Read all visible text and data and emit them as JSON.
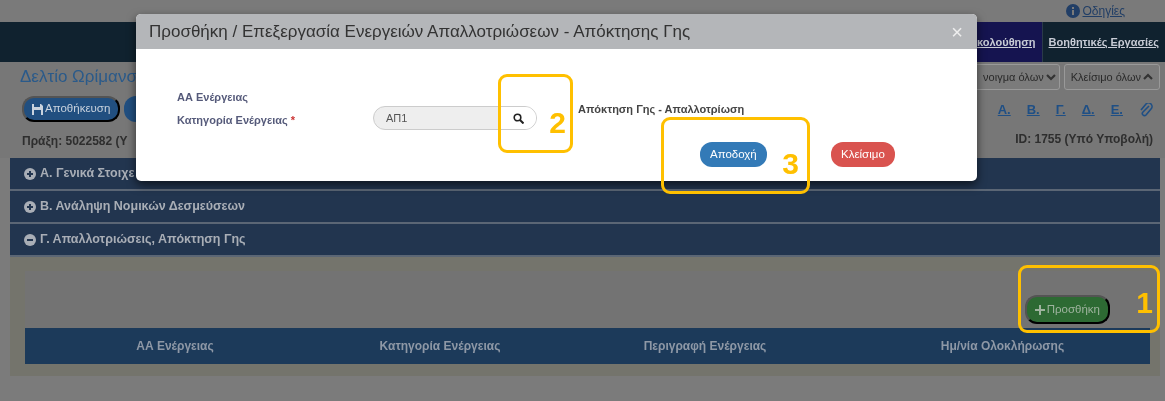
{
  "top_bar": {
    "help_link": "Οδηγίες"
  },
  "nav_tabs": [
    {
      "label": "κολούθηση",
      "selected": true
    },
    {
      "label": "Βοηθητικές Εργασίες",
      "selected": false
    }
  ],
  "page_title": "Δελτίο Ωρίμανσ",
  "toggle_buttons": [
    {
      "label": "νοιγμα όλων",
      "kind": "expand"
    },
    {
      "label": "Κλείσιμο όλων",
      "kind": "collapse"
    }
  ],
  "save_button": "Αποθήκευση",
  "section_links": [
    "Α.",
    "Β.",
    "Γ.",
    "Δ.",
    "Ε."
  ],
  "project_info": "Πράξη: 5022582 (Υ",
  "record_info": "ID: 1755 (Υπό Υποβολή)",
  "sections": [
    {
      "title": "Α. Γενικά Στοιχε",
      "expanded": false
    },
    {
      "title": "Β. Ανάληψη Νομικών Δεσμεύσεων",
      "expanded": false
    },
    {
      "title": "Γ. Απαλλοτριώσεις, Απόκτηση Γης",
      "expanded": true
    }
  ],
  "add_button": "Προσθήκη",
  "table": {
    "columns": [
      "ΑΑ Ενέργειας",
      "Κατηγορία Ενέργειας",
      "Περιγραφή Ενέργειας",
      "Ημ/νία Ολοκλήρωσης"
    ]
  },
  "modal": {
    "title": "Προσθήκη / Επεξεργασία Ενεργειών Απαλλοτριώσεων - Απόκτησης Γης",
    "close": "×",
    "fields": [
      {
        "label": "ΑΑ Ενέργειας"
      },
      {
        "label": "Κατηγορία Ενέργειας",
        "required_mark": "*",
        "value": "ΑΠ1",
        "description": "Απόκτηση Γης - Απαλλοτρίωση"
      }
    ],
    "buttons": [
      {
        "label": "Αποδοχή",
        "kind": "primary"
      },
      {
        "label": "Κλείσιμο",
        "kind": "danger"
      }
    ]
  },
  "callouts": [
    {
      "number": "1"
    },
    {
      "number": "2"
    },
    {
      "number": "3"
    }
  ]
}
